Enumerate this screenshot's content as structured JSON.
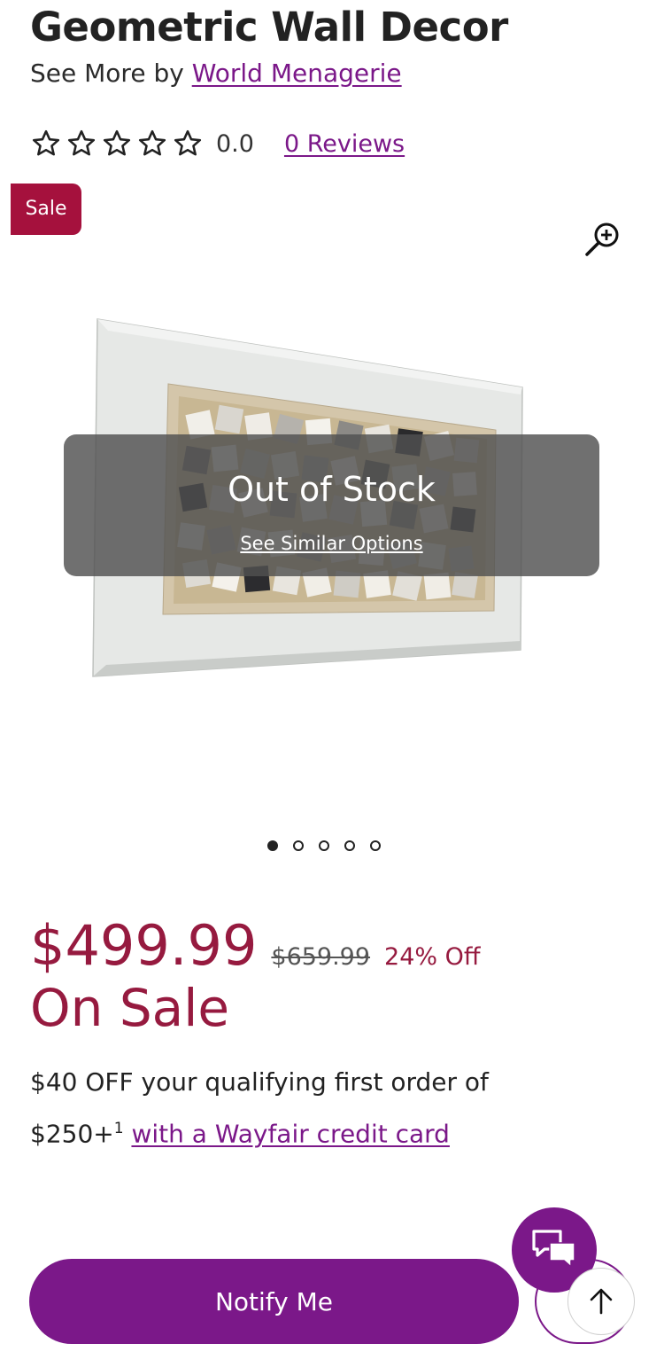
{
  "product": {
    "title": "Geometric Wall Decor",
    "byline_prefix": "See More by",
    "brand": "World Menagerie"
  },
  "rating": {
    "stars_filled": 0,
    "stars_total": 5,
    "value": "0.0",
    "reviews_link": "0 Reviews"
  },
  "badge": {
    "label": "Sale"
  },
  "image_overlay": {
    "title": "Out of Stock",
    "link": "See Similar Options"
  },
  "carousel": {
    "count": 5,
    "active_index": 0
  },
  "pricing": {
    "price": "$499.99",
    "original_price": "$659.99",
    "discount": "24% Off",
    "sale_label": "On Sale"
  },
  "promo": {
    "text": "$40 OFF your qualifying first order of $250+",
    "footnote": "1",
    "link": "with a Wayfair credit card"
  },
  "actions": {
    "notify_label": "Notify Me"
  },
  "icons": {
    "zoom": "zoom-in-icon",
    "chat": "chat-icon",
    "scroll_top": "arrow-up-icon",
    "star": "star-outline-icon"
  },
  "colors": {
    "accent": "#7b1889",
    "sale": "#a5113d",
    "price": "#961a3f"
  }
}
